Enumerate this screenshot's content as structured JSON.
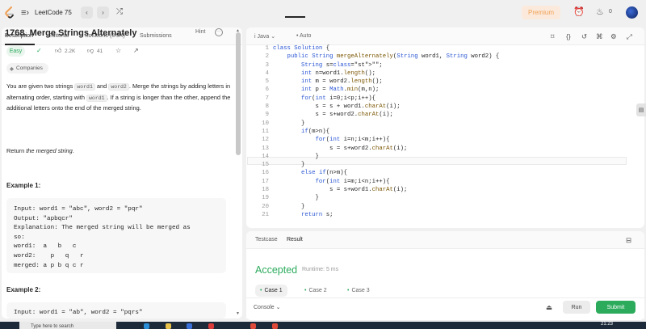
{
  "topbar": {
    "title": "LeetCode 75",
    "premium_label": "Premium",
    "streak_count": "0",
    "icons": [
      "leetcode-logo",
      "menu-icon",
      "chevron-left-icon",
      "chevron-right-icon",
      "shuffle-icon",
      "alarm-clock-icon",
      "fire-icon"
    ]
  },
  "left_tabs": [
    "Description",
    "Editorial",
    "Solutions (3.9K)",
    "Submissions"
  ],
  "problem": {
    "title": "1768. Merge Strings Alternately",
    "hint_label": "Hint",
    "difficulty": "Easy",
    "likes": "2.2K",
    "dislikes": "41",
    "companies_label": "Companies",
    "desc_parts": [
      "You are given two strings ",
      "word1",
      " and ",
      "word2",
      ". Merge the strings by adding letters in alternating order, starting with ",
      "word1",
      ". If a string is longer than the other, append the additional letters onto the end of the merged string."
    ],
    "return_prefix": "Return ",
    "return_em": "the merged string",
    "return_suffix": "."
  },
  "examples": [
    {
      "heading": "Example 1:",
      "body": "Input: word1 = \"abc\", word2 = \"pqr\"\nOutput: \"apbqcr\"\nExplanation: The merged string will be merged as\nso:\nword1:  a   b   c\nword2:    p   q   r\nmerged: a p b q c r"
    },
    {
      "heading": "Example 2:",
      "body": "Input: word1 = \"ab\", word2 = \"pqrs\""
    }
  ],
  "editor": {
    "language": "Java",
    "mode": "Auto",
    "line_numbers": [
      "1",
      "2",
      "3",
      "4",
      "5",
      "6",
      "7",
      "8",
      "9",
      "10",
      "11",
      "12",
      "13",
      "14",
      "15",
      "16",
      "17",
      "18",
      "19",
      "20",
      "21"
    ],
    "lines": [
      "class Solution {",
      "    public String mergeAlternately(String word1, String word2) {",
      "        String s=\"\";",
      "        int n=word1.length();",
      "        int m = word2.length();",
      "        int p = Math.min(m,n);",
      "        for(int i=0;i<p;i++){",
      "            s = s + word1.charAt(i);",
      "            s = s+word2.charAt(i);",
      "        }",
      "        if(m>n){",
      "            for(int i=n;i<m;i++){",
      "                s = s+word2.charAt(i);",
      "            }",
      "        }",
      "        else if(n>m){",
      "            for(int i=m;i<n;i++){",
      "                s = s+word1.charAt(i);",
      "            }",
      "        }",
      "        return s;"
    ]
  },
  "result_panel": {
    "tabs": [
      "Testcase",
      "Result"
    ],
    "status": "Accepted",
    "runtime": "Runtime: 5 ms",
    "cases": [
      "Case 1",
      "Case 2",
      "Case 3"
    ],
    "console_label": "Console",
    "run_label": "Run",
    "submit_label": "Submit"
  },
  "taskbar": {
    "search_placeholder": "Type here to search",
    "time": "21:23"
  },
  "colors": {
    "accent_green": "#2cab5c",
    "premium_orange": "#f0a055",
    "keyword_blue": "#2a56d4"
  }
}
